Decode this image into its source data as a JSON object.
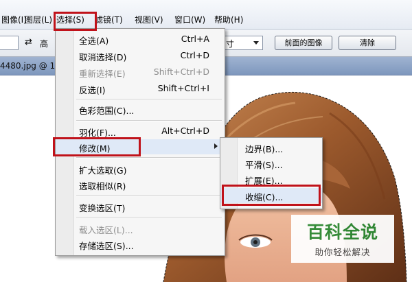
{
  "menubar": {
    "items": [
      "图像(I)",
      "图层(L)",
      "选择(S)",
      "滤镜(T)",
      "视图(V)",
      "窗口(W)",
      "帮助(H)"
    ]
  },
  "options_bar": {
    "swap_glyph": "⇄",
    "height_label": "高",
    "size_select": "寸",
    "front_image_button": "前面的图像",
    "clear_button": "清除"
  },
  "document_tab": {
    "title": "4480.jpg @ 1"
  },
  "select_menu": {
    "items": [
      {
        "label": "全选(A)",
        "shortcut": "Ctrl+A",
        "disabled": false
      },
      {
        "label": "取消选择(D)",
        "shortcut": "Ctrl+D",
        "disabled": false
      },
      {
        "label": "重新选择(E)",
        "shortcut": "Shift+Ctrl+D",
        "disabled": true
      },
      {
        "label": "反选(I)",
        "shortcut": "Shift+Ctrl+I",
        "disabled": false
      },
      {
        "label": "色彩范围(C)...",
        "shortcut": "",
        "disabled": false
      },
      {
        "label": "羽化(F)...",
        "shortcut": "Alt+Ctrl+D",
        "disabled": false
      },
      {
        "label": "修改(M)",
        "shortcut": "",
        "disabled": false
      },
      {
        "label": "扩大选取(G)",
        "shortcut": "",
        "disabled": false
      },
      {
        "label": "选取相似(R)",
        "shortcut": "",
        "disabled": false
      },
      {
        "label": "变换选区(T)",
        "shortcut": "",
        "disabled": false
      },
      {
        "label": "载入选区(L)...",
        "shortcut": "",
        "disabled": true
      },
      {
        "label": "存储选区(S)...",
        "shortcut": "",
        "disabled": false
      }
    ]
  },
  "modify_submenu": {
    "items": [
      "边界(B)...",
      "平滑(S)...",
      "扩展(E)...",
      "收缩(C)..."
    ]
  },
  "watermark": {
    "title": "百科全说",
    "subtitle": "助你轻松解决"
  },
  "colors": {
    "highlight_box": "#c0121a",
    "watermark_green": "#2d8a35"
  }
}
